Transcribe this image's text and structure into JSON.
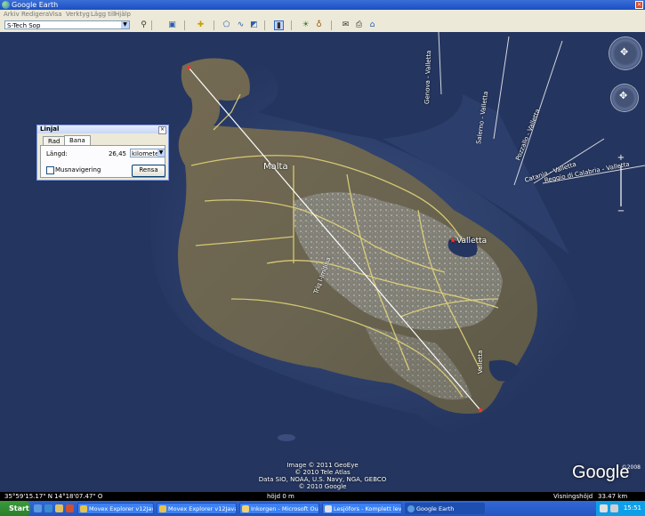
{
  "window": {
    "title": "Google Earth"
  },
  "menu": [
    "Arkiv",
    "Redigera",
    "Visa",
    "Verktyg",
    "Lägg till",
    "Hjälp"
  ],
  "toolbar": {
    "search_select": "S-Tech Sop",
    "buttons": [
      "search-icon",
      "sidebar-icon",
      "placemark-icon",
      "polygon-icon",
      "path-icon",
      "overlay-icon",
      "tour-icon",
      "ruler-icon",
      "sun-icon",
      "planet-icon",
      "email-icon",
      "print-icon",
      "maps-icon"
    ]
  },
  "ruler": {
    "title": "Linjal",
    "tabs": [
      "Rad",
      "Bana"
    ],
    "active_tab": "Bana",
    "length_label": "Längd:",
    "length_value": "26,45",
    "unit": "kilometer",
    "mouse_nav_label": "Musnavigering",
    "mouse_nav_checked": false,
    "clear_label": "Rensa"
  },
  "map": {
    "labels": {
      "island": "Malta",
      "city": "Valletta",
      "road": "Triq l-Imdina"
    },
    "road_labels": [
      "Salerno - Valletta",
      "Pozzallo - Valletta",
      "Catania - Valletta",
      "Reggio di Calabria - Valletta",
      "Genova - Valletta",
      "Valletta"
    ],
    "credits": [
      "Image © 2011 GeoEye",
      "© 2010 Tele Atlas",
      "Data SIO, NOAA, U.S. Navy, NGA, GEBCO",
      "© 2010 Google"
    ],
    "logo": "Google",
    "year_badge": "©2008"
  },
  "status": {
    "coords": "35°59'15.17\" N     14°18'07.47\" O",
    "elevation": "höjd    0 m",
    "eye_alt_label": "Visningshöjd",
    "eye_alt_value": "33.47 km"
  },
  "taskbar": {
    "start": "Start",
    "tasks": [
      "Movex Explorer v12Java...",
      "Movex Explorer v12Java...",
      "Inkorgen - Microsoft Outl...",
      "Lesjöfors - Komplett leve...",
      "Google Earth"
    ],
    "active_task": 4,
    "clock": "15:51"
  },
  "colors": {
    "ocean": "#24355f",
    "land": "#6b6550",
    "taskbar": "#2456c2"
  }
}
